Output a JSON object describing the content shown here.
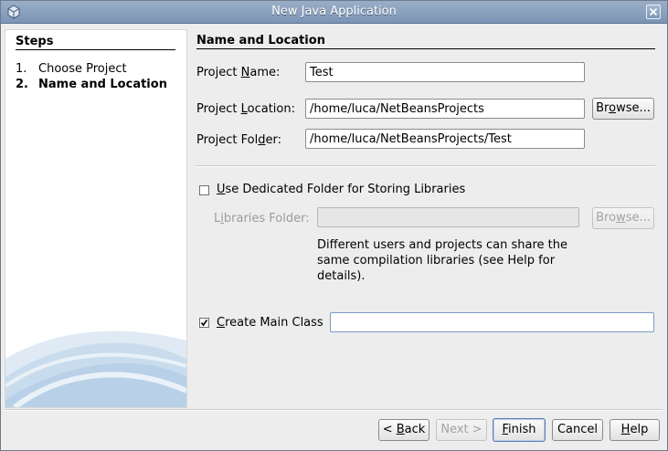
{
  "window": {
    "title": "New Java Application"
  },
  "steps": {
    "heading": "Steps",
    "items": [
      {
        "num": "1.",
        "label": "Choose Project",
        "current": false
      },
      {
        "num": "2.",
        "label": "Name and Location",
        "current": true
      }
    ]
  },
  "section": {
    "title": "Name and Location"
  },
  "form": {
    "project_name": {
      "pre": "Project ",
      "mn": "N",
      "post": "ame:",
      "value": "Test"
    },
    "project_location": {
      "pre": "Project ",
      "mn": "L",
      "post": "ocation:",
      "value": "/home/luca/NetBeansProjects"
    },
    "project_folder": {
      "pre": "Project Fol",
      "mn": "d",
      "post": "er:",
      "value": "/home/luca/NetBeansProjects/Test"
    },
    "browse_label": {
      "pre": "Br",
      "mn": "o",
      "post": "wse..."
    },
    "dedicated_folder": {
      "mn": "U",
      "post": "se Dedicated Folder for Storing Libraries",
      "checked": false
    },
    "libraries_folder": {
      "pre": "L",
      "mn": "i",
      "post": "braries Folder:",
      "value": ""
    },
    "libraries_browse": {
      "pre": "Bro",
      "mn": "w",
      "post": "se..."
    },
    "info_text": "Different users and projects can share the same compilation libraries (see Help for details).",
    "create_main_class": {
      "mn": "C",
      "post": "reate Main Class",
      "checked": true,
      "value": ""
    }
  },
  "buttons": {
    "back": {
      "pre": "< ",
      "mn": "B",
      "post": "ack"
    },
    "next": "Next >",
    "finish": {
      "mn": "F",
      "post": "inish"
    },
    "cancel": "Cancel",
    "help": {
      "mn": "H",
      "post": "elp"
    }
  },
  "colors": {
    "titlebar": "#8aa1bf",
    "accent": "#5c7fb2"
  }
}
